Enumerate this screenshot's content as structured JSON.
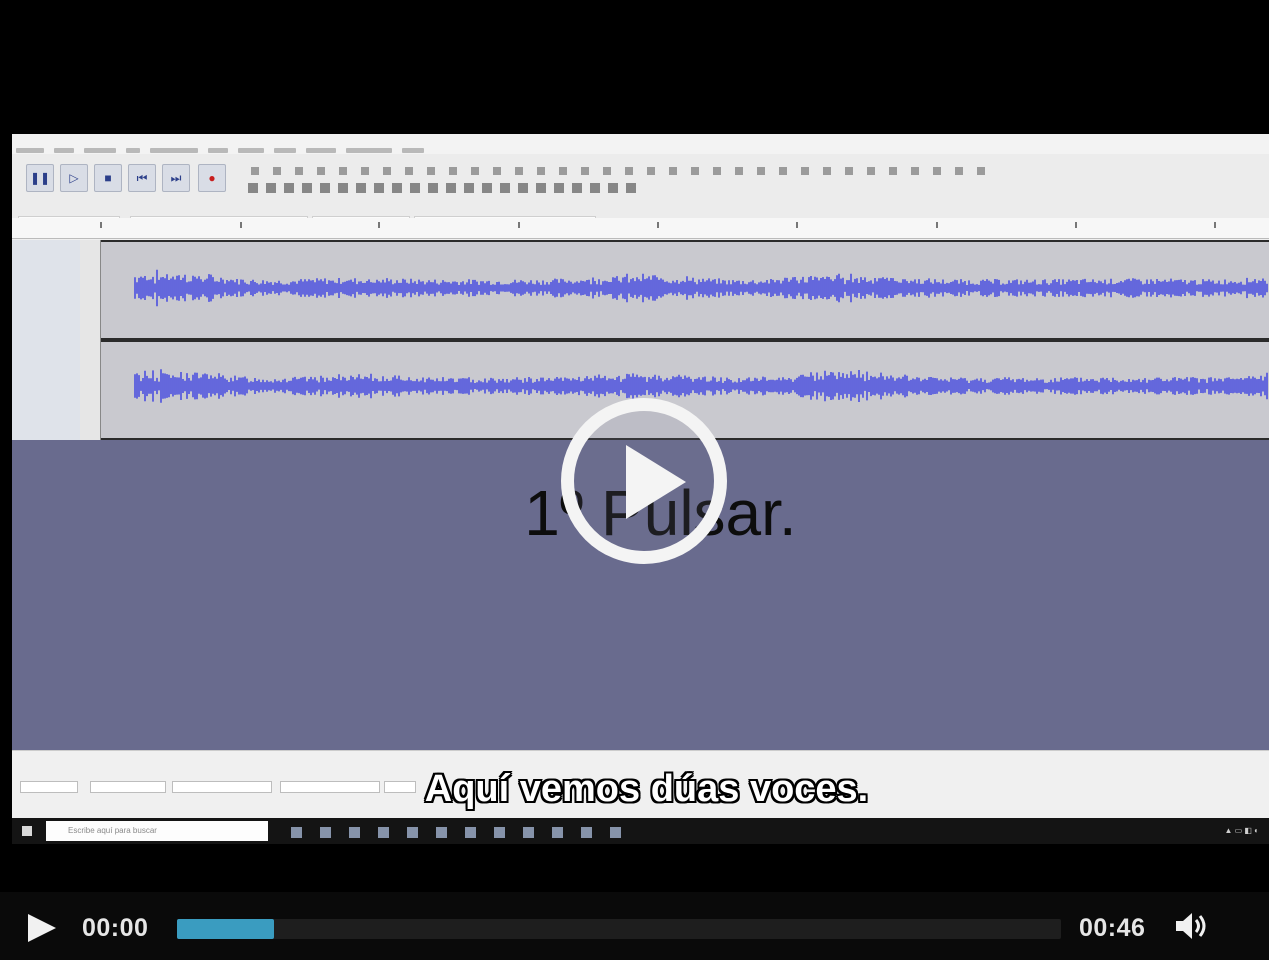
{
  "video": {
    "annotation": "1º Pulsar.",
    "subtitle": "Aquí vemos dúas voces.",
    "taskbar_search_placeholder": "Escribe aquí para buscar"
  },
  "controls": {
    "current_time": "00:00",
    "duration": "00:46",
    "buffered_fraction": 0.11,
    "progress_fraction": 0.0
  },
  "icons": {
    "play": "play-icon",
    "big_play": "play-circle-icon",
    "volume": "volume-icon"
  },
  "colors": {
    "progress_buffer": "#3a9cc0",
    "waveform": "#4b4fe0",
    "empty_area": "#696b8e"
  }
}
